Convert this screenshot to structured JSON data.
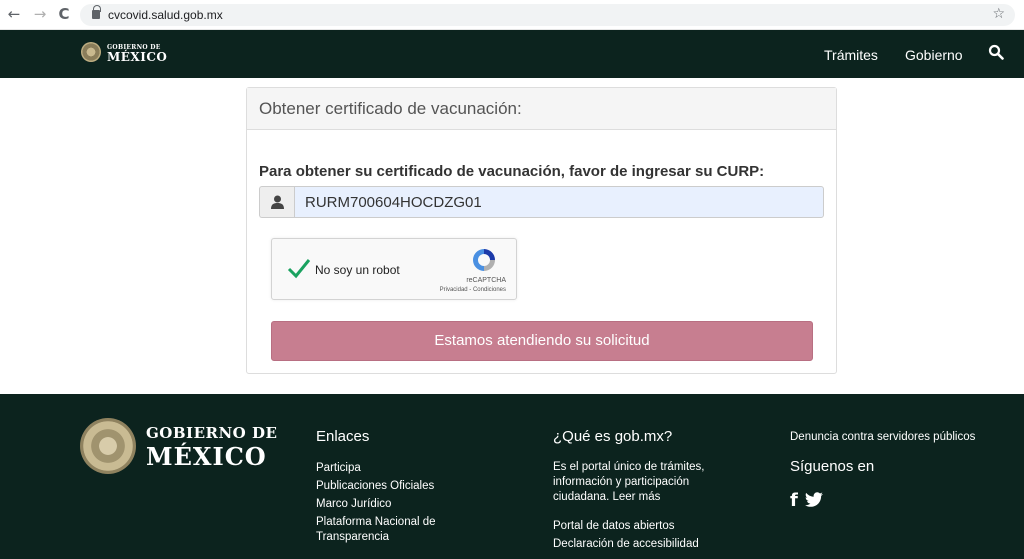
{
  "browser": {
    "url": "cvcovid.salud.gob.mx",
    "back_glyph": "←",
    "forward_glyph": "→",
    "reload_glyph": "C",
    "star_glyph": "☆"
  },
  "header": {
    "logo_top": "GOBIERNO DE",
    "logo_main": "MÉXICO",
    "nav": [
      "Trámites",
      "Gobierno"
    ]
  },
  "card": {
    "title": "Obtener certificado de vacunación:",
    "prompt": "Para obtener su certificado de vacunación, favor de ingresar su CURP:",
    "curp_value": "RURM700604HOCDZG01",
    "captcha_label": "No soy un robot",
    "captcha_brand": "reCAPTCHA",
    "captcha_links": "Privacidad - Condiciones",
    "submit_label": "Estamos atendiendo su solicitud"
  },
  "footer": {
    "brand_top": "GOBIERNO DE",
    "brand_main": "MÉXICO",
    "links_title": "Enlaces",
    "links": [
      "Participa",
      "Publicaciones Oficiales",
      "Marco Jurídico",
      "Plataforma Nacional de Transparencia"
    ],
    "what_title": "¿Qué es gob.mx?",
    "what_text": "Es el portal único de trámites, información y participación ciudadana. Leer más",
    "what_links": [
      "Portal de datos abiertos",
      "Declaración de accesibilidad"
    ],
    "denuncia": "Denuncia contra servidores públicos",
    "follow_title": "Síguenos en",
    "facebook_glyph": "f"
  },
  "colors": {
    "header_bg": "#0c231e",
    "button_bg": "#c77e90",
    "input_bg": "#e8f0fe"
  },
  "icons": [
    "lock-icon",
    "star-icon",
    "search-icon",
    "user-icon",
    "checkmark-icon",
    "recaptcha-logo",
    "facebook-icon",
    "twitter-icon"
  ]
}
